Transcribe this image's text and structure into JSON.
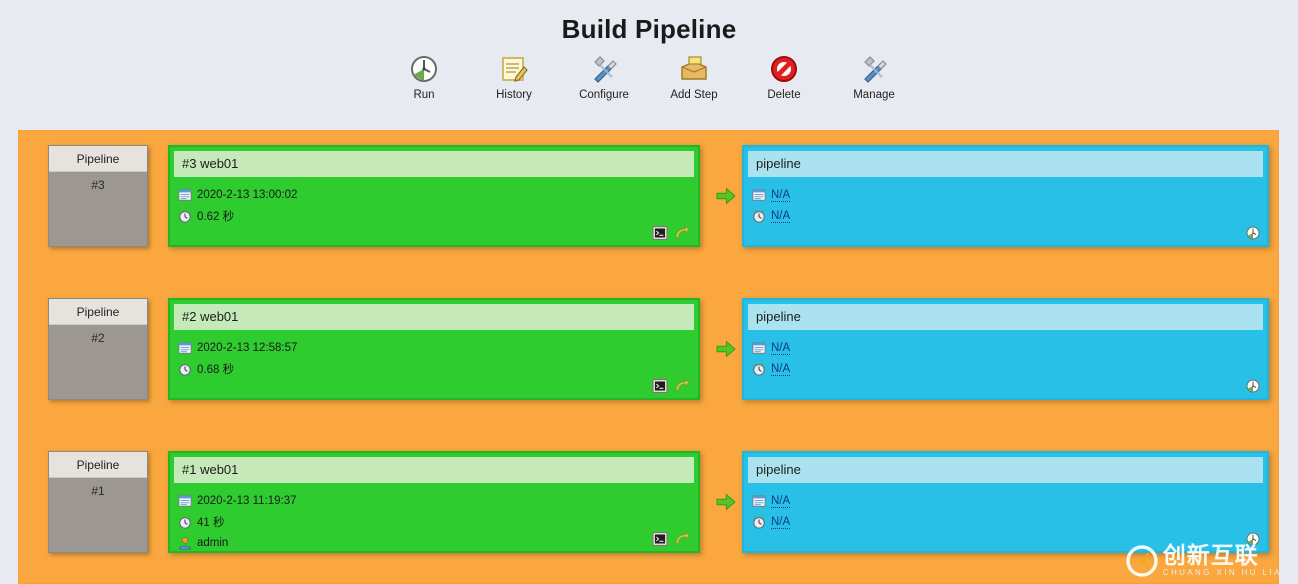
{
  "header": {
    "title": "Build Pipeline",
    "toolbar": [
      {
        "label": "Run",
        "icon": "run-clock-icon"
      },
      {
        "label": "History",
        "icon": "notepad-pencil-icon"
      },
      {
        "label": "Configure",
        "icon": "wrench-screwdriver-icon"
      },
      {
        "label": "Add Step",
        "icon": "package-box-icon"
      },
      {
        "label": "Delete",
        "icon": "no-entry-icon"
      },
      {
        "label": "Manage",
        "icon": "wrench-screwdriver-icon"
      }
    ]
  },
  "colors": {
    "page_background": "#e7eaf1",
    "panel_orange": "#f9a73e",
    "build_green": "#2ecc2e",
    "build_green_header": "#c6e9b9",
    "step_blue": "#29c0e8",
    "step_blue_header": "#aae3ef",
    "pipeline_grey": "#9d9791",
    "pipeline_grey_header": "#e6e2dd",
    "link_blue": "#123a8a"
  },
  "pipeline_rows": [
    {
      "pipeline": {
        "title": "Pipeline",
        "number": "#3"
      },
      "build": {
        "header": "#3 web01",
        "meta": [
          {
            "icon": "calendar-icon",
            "text": "2020-2-13 13:00:02"
          },
          {
            "icon": "clock-icon",
            "text": "0.62 秒"
          }
        ],
        "actions": [
          {
            "icon": "console-icon",
            "name": "console-output-button"
          },
          {
            "icon": "rerun-arrow-icon",
            "name": "rerun-button"
          }
        ]
      },
      "connector": {
        "icon": "arrow-right-icon"
      },
      "step": {
        "header": "pipeline",
        "meta": [
          {
            "icon": "calendar-icon",
            "text": "N/A"
          },
          {
            "icon": "clock-icon",
            "text": "N/A"
          }
        ],
        "action": {
          "icon": "run-clock-icon",
          "name": "run-step-button"
        }
      }
    },
    {
      "pipeline": {
        "title": "Pipeline",
        "number": "#2"
      },
      "build": {
        "header": "#2 web01",
        "meta": [
          {
            "icon": "calendar-icon",
            "text": "2020-2-13 12:58:57"
          },
          {
            "icon": "clock-icon",
            "text": "0.68 秒"
          }
        ],
        "actions": [
          {
            "icon": "console-icon",
            "name": "console-output-button"
          },
          {
            "icon": "rerun-arrow-icon",
            "name": "rerun-button"
          }
        ]
      },
      "connector": {
        "icon": "arrow-right-icon"
      },
      "step": {
        "header": "pipeline",
        "meta": [
          {
            "icon": "calendar-icon",
            "text": "N/A"
          },
          {
            "icon": "clock-icon",
            "text": "N/A"
          }
        ],
        "action": {
          "icon": "run-clock-icon",
          "name": "run-step-button"
        }
      }
    },
    {
      "pipeline": {
        "title": "Pipeline",
        "number": "#1"
      },
      "build": {
        "header": "#1 web01",
        "meta": [
          {
            "icon": "calendar-icon",
            "text": "2020-2-13 11:19:37"
          },
          {
            "icon": "clock-icon",
            "text": "41 秒"
          },
          {
            "icon": "user-icon",
            "text": "admin"
          }
        ],
        "actions": [
          {
            "icon": "console-icon",
            "name": "console-output-button"
          },
          {
            "icon": "rerun-arrow-icon",
            "name": "rerun-button"
          }
        ]
      },
      "connector": {
        "icon": "arrow-right-icon"
      },
      "step": {
        "header": "pipeline",
        "meta": [
          {
            "icon": "calendar-icon",
            "text": "N/A"
          },
          {
            "icon": "clock-icon",
            "text": "N/A"
          }
        ],
        "action": {
          "icon": "run-clock-icon",
          "name": "run-step-button"
        }
      }
    }
  ],
  "watermark": {
    "cn": "创新互联",
    "en": "CHUANG XIN HU LIAN"
  }
}
